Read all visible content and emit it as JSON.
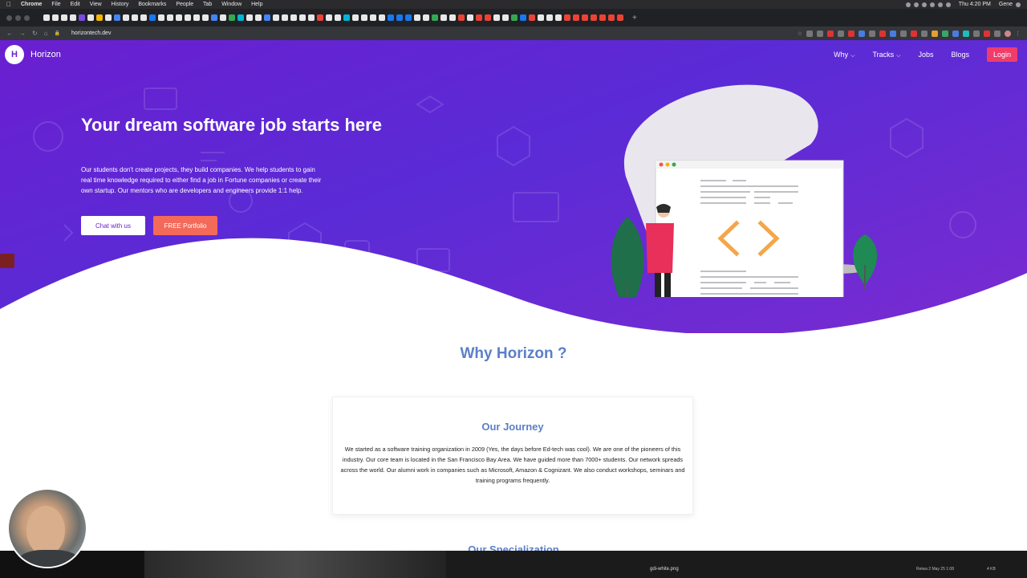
{
  "menubar": {
    "app": "Chrome",
    "menus": [
      "File",
      "Edit",
      "View",
      "History",
      "Bookmarks",
      "People",
      "Tab",
      "Window",
      "Help"
    ],
    "clock": "Thu 4:20 PM",
    "user": "Gene"
  },
  "browser": {
    "url": "horizontech.dev"
  },
  "site": {
    "brand": "Horizon",
    "logo_glyph": "H",
    "nav": [
      {
        "label": "Why",
        "has_chevron": true
      },
      {
        "label": "Tracks",
        "has_chevron": true
      },
      {
        "label": "Jobs",
        "has_chevron": false
      },
      {
        "label": "Blogs",
        "has_chevron": false
      }
    ],
    "login_label": "Login",
    "colors": {
      "brand_purple": "#6a1fd0",
      "login_pink": "#f03c6a",
      "accent_blue": "#5b7fc9",
      "free_btn": "#f36a5a"
    }
  },
  "hero": {
    "title": "Your dream software job starts here",
    "description": "Our students don't create projects, they build companies. We help students to gain real time knowledge required to either find a job in Fortune companies or create their own startup. Our mentors who are developers and engineers provide 1:1 help.",
    "chat_label": "Chat with us",
    "free_label": "FREE Portfolio"
  },
  "why": {
    "title": "Why Horizon ?",
    "card_title": "Our Journey",
    "card_text": "We started as a software training organization in 2009 (Yes, the days before Ed-tech was cool). We are one of the pioneers of this industry. Our core team is located in the San Francisco Bay Area. We have guided more than 7000+ students. Our network spreads across the world. Our alumni work in companies such as Microsoft, Amazon & Cognizant. We also conduct workshops, seminars and training programs frequently.",
    "next_title": "Our Specialization"
  },
  "statusbar": {
    "file": "gdi-white.png",
    "meta": "Reiwa 2 May 25 1:08",
    "size": "4 KB"
  }
}
